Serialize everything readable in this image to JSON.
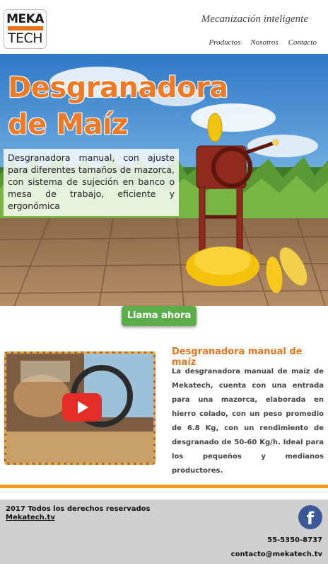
{
  "header": {
    "logo_top": "MEKA",
    "logo_bottom": "TECH",
    "tagline": "Mecanización inteligente",
    "nav": [
      "Productos",
      "Nosotros",
      "Contacto"
    ]
  },
  "hero": {
    "title_line1": "Desgranadora",
    "title_line2": "de Maíz",
    "description": "Desgranadora manual, con ajuste para diferentes tamaños de mazorca, con sistema de sujeción en banco o mesa de trabajo, eficiente y ergonómica",
    "cta_label": "Llama ahora"
  },
  "product": {
    "title": "Desgranadora manual de maíz",
    "body": "La desgranadora manual de maíz de Mekatech, cuenta con una entrada para una mazorca, elaborada en hierro colado, con un peso promedio de 6.8 Kg, con un rendimiento de desgranado de 50-60 Kg/h. Ideal para los pequeños y medianos productores."
  },
  "footer": {
    "copyright": "2017 Todos los derechos reservados",
    "site_link": "Mekatech.tv",
    "phone": "55-5350-8737",
    "email": "contacto@mekatech.tv",
    "facebook_icon": "facebook-icon"
  },
  "colors": {
    "brand_orange": "#e8731c",
    "cta_green": "#5cae4b",
    "footer_gray": "#cfcfcf"
  }
}
